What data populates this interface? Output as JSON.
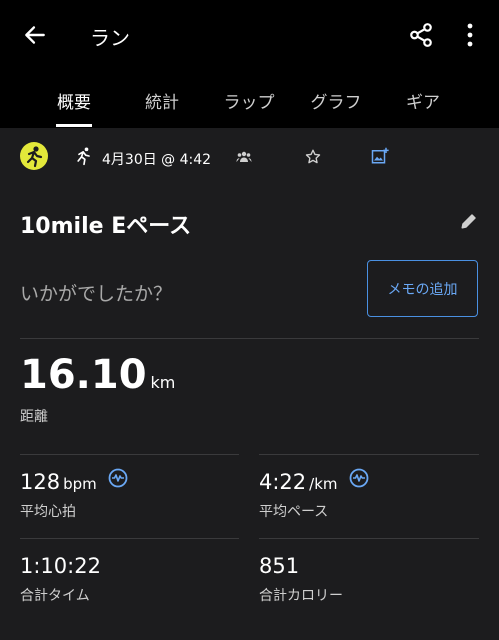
{
  "header": {
    "title": "ラン"
  },
  "tabs": [
    {
      "label": "概要"
    },
    {
      "label": "統計"
    },
    {
      "label": "ラップ"
    },
    {
      "label": "グラフ"
    },
    {
      "label": "ギア"
    }
  ],
  "info": {
    "date": "4月30日 @ 4:42"
  },
  "activity": {
    "name": "10mile Eペース"
  },
  "note": {
    "prompt": "いかがでしたか？",
    "button": "メモの追加"
  },
  "distance": {
    "value": "16.10",
    "unit": "km",
    "label": "距離"
  },
  "stats": [
    {
      "value": "128",
      "unit": "bpm",
      "label": "平均心拍"
    },
    {
      "value": "4:22",
      "unit": "/km",
      "label": "平均ペース"
    },
    {
      "value": "1:10:22",
      "unit": "",
      "label": "合計タイム"
    },
    {
      "value": "851",
      "unit": "",
      "label": "合計カロリー"
    }
  ],
  "colors": {
    "accent": "#4a90e2",
    "logo": "#e3e83a",
    "background": "#1c1c1e",
    "header": "#000000"
  }
}
